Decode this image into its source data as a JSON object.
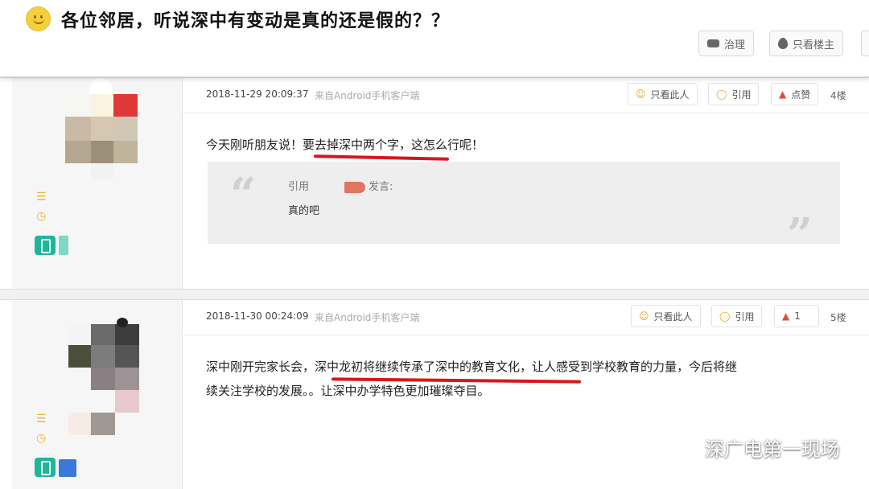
{
  "thread": {
    "title": "各位邻居，听说深中有变动是真的还是假的？？",
    "buttons": {
      "reply": "治理",
      "only_op": "只看楼主"
    }
  },
  "posts": [
    {
      "time": "2018-11-29 20:09:37",
      "source": "来自Android手机客户端",
      "only_this": "只看此人",
      "quote_btn": "引用",
      "like": "点赞",
      "floor": "4楼",
      "text_before": "今天刚听朋友说！",
      "text_highlight": "要去掉深中两个字",
      "text_after": "，这怎么行呢！",
      "quote": {
        "label": "引用",
        "said": "发言:",
        "body": "真的吧"
      }
    },
    {
      "time": "2018-11-30 00:24:09",
      "source": "来自Android手机客户端",
      "only_this": "只看此人",
      "quote_btn": "引用",
      "like": "1",
      "floor": "5楼",
      "text_before": "深中刚开完家长会，",
      "text_highlight": "深中龙初将继续传承了深中的教育文化",
      "text_after": "，让人感受到学校教育的力量，今后将继",
      "text_line2": "续关注学校的发展。。让深中办学特色更加璀璨夺目。"
    }
  ],
  "watermark": {
    "text": "深广电第一现场"
  },
  "icons": {
    "reply_icon": "comment-icon",
    "op_icon": "drop-icon",
    "only_this_icon": "person-icon",
    "quote_icon": "quote-bubble-icon",
    "like_icon": "thumbs-up-icon",
    "mobile_icon": "phone-icon",
    "wechat_icon": "wechat-icon"
  },
  "colors": {
    "highlight_underline": "#d81818",
    "accent_orange": "#f0a020",
    "mobile_green": "#1fb69a"
  }
}
